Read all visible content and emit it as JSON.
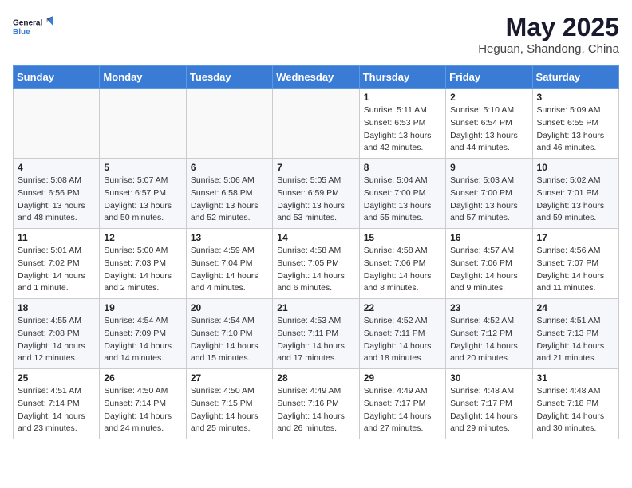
{
  "logo": {
    "line1": "General",
    "line2": "Blue"
  },
  "title": "May 2025",
  "subtitle": "Heguan, Shandong, China",
  "days_of_week": [
    "Sunday",
    "Monday",
    "Tuesday",
    "Wednesday",
    "Thursday",
    "Friday",
    "Saturday"
  ],
  "weeks": [
    [
      {
        "day": "",
        "info": ""
      },
      {
        "day": "",
        "info": ""
      },
      {
        "day": "",
        "info": ""
      },
      {
        "day": "",
        "info": ""
      },
      {
        "day": "1",
        "info": "Sunrise: 5:11 AM\nSunset: 6:53 PM\nDaylight: 13 hours\nand 42 minutes."
      },
      {
        "day": "2",
        "info": "Sunrise: 5:10 AM\nSunset: 6:54 PM\nDaylight: 13 hours\nand 44 minutes."
      },
      {
        "day": "3",
        "info": "Sunrise: 5:09 AM\nSunset: 6:55 PM\nDaylight: 13 hours\nand 46 minutes."
      }
    ],
    [
      {
        "day": "4",
        "info": "Sunrise: 5:08 AM\nSunset: 6:56 PM\nDaylight: 13 hours\nand 48 minutes."
      },
      {
        "day": "5",
        "info": "Sunrise: 5:07 AM\nSunset: 6:57 PM\nDaylight: 13 hours\nand 50 minutes."
      },
      {
        "day": "6",
        "info": "Sunrise: 5:06 AM\nSunset: 6:58 PM\nDaylight: 13 hours\nand 52 minutes."
      },
      {
        "day": "7",
        "info": "Sunrise: 5:05 AM\nSunset: 6:59 PM\nDaylight: 13 hours\nand 53 minutes."
      },
      {
        "day": "8",
        "info": "Sunrise: 5:04 AM\nSunset: 7:00 PM\nDaylight: 13 hours\nand 55 minutes."
      },
      {
        "day": "9",
        "info": "Sunrise: 5:03 AM\nSunset: 7:00 PM\nDaylight: 13 hours\nand 57 minutes."
      },
      {
        "day": "10",
        "info": "Sunrise: 5:02 AM\nSunset: 7:01 PM\nDaylight: 13 hours\nand 59 minutes."
      }
    ],
    [
      {
        "day": "11",
        "info": "Sunrise: 5:01 AM\nSunset: 7:02 PM\nDaylight: 14 hours\nand 1 minute."
      },
      {
        "day": "12",
        "info": "Sunrise: 5:00 AM\nSunset: 7:03 PM\nDaylight: 14 hours\nand 2 minutes."
      },
      {
        "day": "13",
        "info": "Sunrise: 4:59 AM\nSunset: 7:04 PM\nDaylight: 14 hours\nand 4 minutes."
      },
      {
        "day": "14",
        "info": "Sunrise: 4:58 AM\nSunset: 7:05 PM\nDaylight: 14 hours\nand 6 minutes."
      },
      {
        "day": "15",
        "info": "Sunrise: 4:58 AM\nSunset: 7:06 PM\nDaylight: 14 hours\nand 8 minutes."
      },
      {
        "day": "16",
        "info": "Sunrise: 4:57 AM\nSunset: 7:06 PM\nDaylight: 14 hours\nand 9 minutes."
      },
      {
        "day": "17",
        "info": "Sunrise: 4:56 AM\nSunset: 7:07 PM\nDaylight: 14 hours\nand 11 minutes."
      }
    ],
    [
      {
        "day": "18",
        "info": "Sunrise: 4:55 AM\nSunset: 7:08 PM\nDaylight: 14 hours\nand 12 minutes."
      },
      {
        "day": "19",
        "info": "Sunrise: 4:54 AM\nSunset: 7:09 PM\nDaylight: 14 hours\nand 14 minutes."
      },
      {
        "day": "20",
        "info": "Sunrise: 4:54 AM\nSunset: 7:10 PM\nDaylight: 14 hours\nand 15 minutes."
      },
      {
        "day": "21",
        "info": "Sunrise: 4:53 AM\nSunset: 7:11 PM\nDaylight: 14 hours\nand 17 minutes."
      },
      {
        "day": "22",
        "info": "Sunrise: 4:52 AM\nSunset: 7:11 PM\nDaylight: 14 hours\nand 18 minutes."
      },
      {
        "day": "23",
        "info": "Sunrise: 4:52 AM\nSunset: 7:12 PM\nDaylight: 14 hours\nand 20 minutes."
      },
      {
        "day": "24",
        "info": "Sunrise: 4:51 AM\nSunset: 7:13 PM\nDaylight: 14 hours\nand 21 minutes."
      }
    ],
    [
      {
        "day": "25",
        "info": "Sunrise: 4:51 AM\nSunset: 7:14 PM\nDaylight: 14 hours\nand 23 minutes."
      },
      {
        "day": "26",
        "info": "Sunrise: 4:50 AM\nSunset: 7:14 PM\nDaylight: 14 hours\nand 24 minutes."
      },
      {
        "day": "27",
        "info": "Sunrise: 4:50 AM\nSunset: 7:15 PM\nDaylight: 14 hours\nand 25 minutes."
      },
      {
        "day": "28",
        "info": "Sunrise: 4:49 AM\nSunset: 7:16 PM\nDaylight: 14 hours\nand 26 minutes."
      },
      {
        "day": "29",
        "info": "Sunrise: 4:49 AM\nSunset: 7:17 PM\nDaylight: 14 hours\nand 27 minutes."
      },
      {
        "day": "30",
        "info": "Sunrise: 4:48 AM\nSunset: 7:17 PM\nDaylight: 14 hours\nand 29 minutes."
      },
      {
        "day": "31",
        "info": "Sunrise: 4:48 AM\nSunset: 7:18 PM\nDaylight: 14 hours\nand 30 minutes."
      }
    ]
  ]
}
